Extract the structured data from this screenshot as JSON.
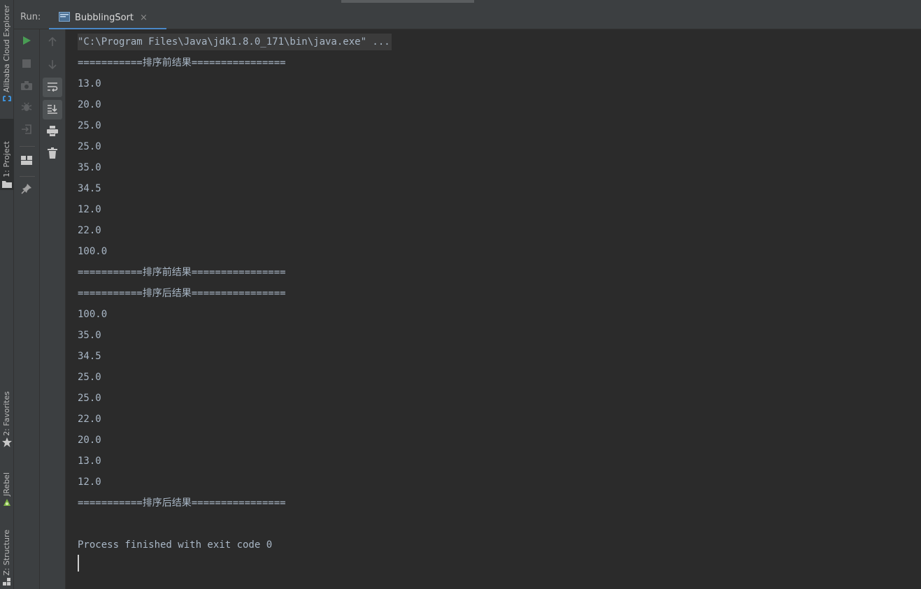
{
  "left_strip": {
    "items": [
      {
        "label": "Alibaba Cloud Explorer",
        "icon": "alibaba-cloud-icon"
      },
      {
        "label": "1: Project",
        "icon": "folder-icon"
      },
      {
        "label": "2: Favorites",
        "icon": "star-icon"
      },
      {
        "label": "JRebel",
        "icon": "jrebel-icon"
      },
      {
        "label": "Z: Structure",
        "icon": "structure-icon"
      }
    ]
  },
  "run": {
    "label": "Run:",
    "tab_label": "BubblingSort",
    "close_glyph": "×"
  },
  "toolbar1": {
    "icons": [
      "run-icon",
      "stop-icon",
      "camera-icon",
      "debug-icon",
      "login-icon",
      "layout-icon",
      "pin-icon"
    ]
  },
  "toolbar2": {
    "icons": [
      "up-arrow-icon",
      "down-arrow-icon",
      "soft-wrap-icon",
      "scroll-to-end-icon",
      "print-icon",
      "trash-icon"
    ]
  },
  "console": {
    "command": "\"C:\\Program Files\\Java\\jdk1.8.0_171\\bin\\java.exe\" ...",
    "lines": [
      "===========排序前结果================",
      "13.0",
      "20.0",
      "25.0",
      "25.0",
      "35.0",
      "34.5",
      "12.0",
      "22.0",
      "100.0",
      "===========排序前结果================",
      "===========排序后结果================",
      "100.0",
      "35.0",
      "34.5",
      "25.0",
      "25.0",
      "22.0",
      "20.0",
      "13.0",
      "12.0",
      "===========排序后结果================",
      "",
      "Process finished with exit code 0"
    ]
  },
  "colors": {
    "run_green": "#499c54",
    "tab_underline": "#4a88c7",
    "console_bg": "#2b2b2b",
    "panel_bg": "#3c3f41"
  }
}
